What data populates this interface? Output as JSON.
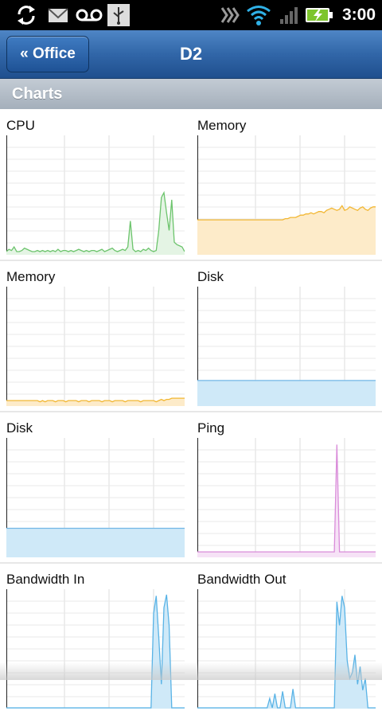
{
  "status_bar": {
    "time": "3:00",
    "icons": [
      "sync-icon",
      "gmail-icon",
      "voicemail-icon",
      "usb-icon",
      "signal-strength-icon",
      "wifi-icon",
      "cell-signal-icon",
      "battery-charging-icon"
    ]
  },
  "header": {
    "back_label": "« Office",
    "title": "D2"
  },
  "section": {
    "title": "Charts"
  },
  "charts": [
    {
      "label": "CPU",
      "line_color": "#6cc46c",
      "fill_color": "#e4f4e4",
      "values": [
        2,
        4,
        3,
        6,
        2,
        2,
        3,
        5,
        4,
        3,
        2,
        2,
        3,
        2,
        3,
        2,
        3,
        2,
        3,
        2,
        4,
        2,
        3,
        3,
        2,
        3,
        2,
        3,
        4,
        3,
        2,
        3,
        2,
        3,
        3,
        2,
        3,
        4,
        2,
        3,
        4,
        5,
        3,
        2,
        3,
        4,
        3,
        6,
        28,
        4,
        2,
        3,
        2,
        4,
        3,
        5,
        3,
        2,
        3,
        20,
        48,
        52,
        35,
        20,
        46,
        10,
        8,
        7,
        6,
        2
      ]
    },
    {
      "label": "Memory",
      "line_color": "#f2b733",
      "fill_color": "#fdebc9",
      "values": [
        29,
        29,
        29,
        29,
        29,
        29,
        29,
        29,
        29,
        29,
        29,
        29,
        29,
        29,
        29,
        29,
        29,
        29,
        29,
        29,
        29,
        29,
        29,
        29,
        29,
        29,
        29,
        29,
        29,
        29,
        29,
        29,
        29,
        29,
        30,
        30,
        31,
        31,
        31,
        32,
        33,
        33,
        34,
        34,
        35,
        34,
        35,
        36,
        36,
        35,
        37,
        38,
        39,
        38,
        37,
        38,
        41,
        37,
        38,
        40,
        39,
        38,
        37,
        39,
        40,
        38,
        37,
        39,
        40,
        40
      ]
    },
    {
      "label": "Memory",
      "line_color": "#f2b733",
      "fill_color": "#fdebc9",
      "values": [
        4,
        4,
        4,
        4,
        4,
        4,
        4,
        4,
        4,
        4,
        4,
        4,
        4,
        3,
        4,
        3,
        4,
        4,
        4,
        3,
        4,
        4,
        4,
        3,
        4,
        4,
        4,
        4,
        3,
        4,
        4,
        4,
        3,
        4,
        4,
        4,
        4,
        3,
        4,
        4,
        4,
        3,
        4,
        4,
        4,
        4,
        3,
        4,
        4,
        4,
        4,
        4,
        3,
        4,
        4,
        4,
        4,
        4,
        3,
        4,
        5,
        4,
        5,
        5,
        6,
        6,
        6,
        6,
        6,
        6
      ]
    },
    {
      "label": "Disk",
      "line_color": "#72b7e6",
      "fill_color": "#cfe9f8",
      "values": [
        21,
        21,
        21,
        21,
        21,
        21,
        21,
        21,
        21,
        21,
        21,
        21,
        21,
        21,
        21,
        21,
        21,
        21,
        21,
        21,
        21,
        21,
        21,
        21,
        21,
        21,
        21,
        21,
        21,
        21,
        21,
        21,
        21,
        21,
        21,
        21,
        21,
        21,
        21,
        21,
        21,
        21,
        21,
        21,
        21,
        21,
        21,
        21,
        21,
        21,
        21,
        21,
        21,
        21,
        21,
        21,
        21,
        21,
        21,
        21,
        21,
        21,
        21,
        21,
        21,
        21,
        21,
        21,
        21,
        21
      ]
    },
    {
      "label": "Disk",
      "line_color": "#72b7e6",
      "fill_color": "#cfe9f8",
      "values": [
        24,
        24,
        24,
        24,
        24,
        24,
        24,
        24,
        24,
        24,
        24,
        24,
        24,
        24,
        24,
        24,
        24,
        24,
        24,
        24,
        24,
        24,
        24,
        24,
        24,
        24,
        24,
        24,
        24,
        24,
        24,
        24,
        24,
        24,
        24,
        24,
        24,
        24,
        24,
        24,
        24,
        24,
        24,
        24,
        24,
        24,
        24,
        24,
        24,
        24,
        24,
        24,
        24,
        24,
        24,
        24,
        24,
        24,
        24,
        24,
        24,
        24,
        24,
        24,
        24,
        24,
        24,
        24,
        24,
        24
      ]
    },
    {
      "label": "Ping",
      "line_color": "#d98bd9",
      "fill_color": "#f6e2f6",
      "values": [
        4,
        4,
        4,
        4,
        4,
        4,
        4,
        4,
        4,
        4,
        4,
        4,
        4,
        4,
        4,
        4,
        4,
        4,
        4,
        4,
        4,
        4,
        4,
        4,
        4,
        4,
        4,
        4,
        4,
        4,
        4,
        4,
        4,
        4,
        4,
        4,
        4,
        4,
        4,
        4,
        4,
        4,
        4,
        4,
        4,
        4,
        4,
        4,
        4,
        4,
        4,
        4,
        4,
        4,
        95,
        4,
        4,
        4,
        4,
        4,
        4,
        4,
        4,
        4,
        4,
        4,
        4,
        4,
        4,
        4
      ]
    },
    {
      "label": "Bandwidth In",
      "line_color": "#59b3e6",
      "fill_color": "#cfe9f8",
      "values": [
        0,
        0,
        0,
        0,
        0,
        0,
        0,
        0,
        0,
        0,
        0,
        0,
        0,
        0,
        0,
        0,
        0,
        0,
        0,
        0,
        0,
        0,
        0,
        0,
        0,
        0,
        0,
        0,
        0,
        0,
        0,
        0,
        0,
        0,
        0,
        0,
        0,
        0,
        0,
        0,
        0,
        0,
        0,
        0,
        0,
        0,
        0,
        0,
        0,
        0,
        0,
        0,
        0,
        0,
        0,
        0,
        0,
        80,
        95,
        60,
        20,
        85,
        96,
        70,
        0,
        0,
        0,
        0,
        0,
        0
      ]
    },
    {
      "label": "Bandwidth Out",
      "line_color": "#59b3e6",
      "fill_color": "#cfe9f8",
      "values": [
        0,
        0,
        0,
        0,
        0,
        0,
        0,
        0,
        0,
        0,
        0,
        0,
        0,
        0,
        0,
        0,
        0,
        0,
        0,
        0,
        0,
        0,
        0,
        0,
        0,
        0,
        0,
        0,
        8,
        0,
        12,
        0,
        0,
        14,
        0,
        0,
        0,
        16,
        0,
        0,
        0,
        0,
        0,
        0,
        0,
        0,
        0,
        0,
        0,
        0,
        0,
        0,
        0,
        0,
        90,
        70,
        95,
        85,
        40,
        25,
        30,
        45,
        20,
        35,
        15,
        25,
        0,
        0,
        0,
        0
      ]
    }
  ]
}
